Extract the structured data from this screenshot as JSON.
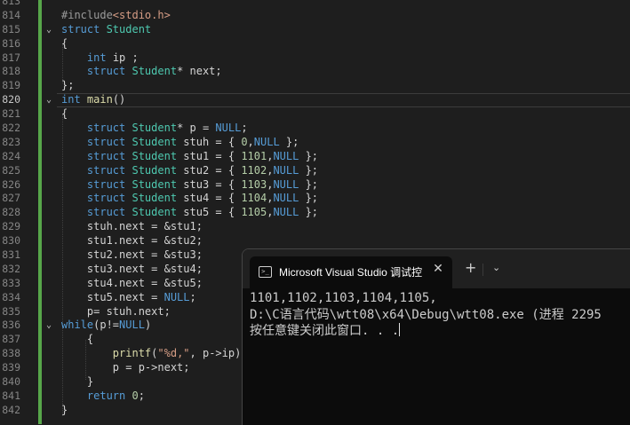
{
  "editor": {
    "lines": [
      {
        "num": "813",
        "code": []
      },
      {
        "num": "814",
        "code": [
          [
            "pre",
            "#include"
          ],
          [
            "str",
            "<stdio.h>"
          ]
        ]
      },
      {
        "num": "815",
        "fold": "⌄",
        "code": [
          [
            "kw",
            "struct "
          ],
          [
            "ty",
            "Student"
          ]
        ]
      },
      {
        "num": "816",
        "code": [
          [
            "",
            "{"
          ]
        ]
      },
      {
        "num": "817",
        "code": [
          [
            "",
            "    "
          ],
          [
            "kw",
            "int"
          ],
          [
            "",
            " ip ;"
          ]
        ]
      },
      {
        "num": "818",
        "code": [
          [
            "",
            "    "
          ],
          [
            "kw",
            "struct "
          ],
          [
            "ty",
            "Student"
          ],
          [
            "",
            "* next;"
          ]
        ]
      },
      {
        "num": "819",
        "code": [
          [
            "",
            "};"
          ]
        ]
      },
      {
        "num": "820",
        "fold": "⌄",
        "active": true,
        "code": [
          [
            "kw",
            "int "
          ],
          [
            "fn",
            "main"
          ],
          [
            "",
            "()"
          ]
        ]
      },
      {
        "num": "821",
        "code": [
          [
            "",
            "{"
          ]
        ]
      },
      {
        "num": "822",
        "code": [
          [
            "",
            "    "
          ],
          [
            "kw",
            "struct "
          ],
          [
            "ty",
            "Student"
          ],
          [
            "",
            "* p = "
          ],
          [
            "kw",
            "NULL"
          ],
          [
            "",
            ";"
          ]
        ]
      },
      {
        "num": "823",
        "code": [
          [
            "",
            "    "
          ],
          [
            "kw",
            "struct "
          ],
          [
            "ty",
            "Student"
          ],
          [
            "",
            " stuh = { "
          ],
          [
            "num",
            "0"
          ],
          [
            "",
            ","
          ],
          [
            "kw",
            "NULL"
          ],
          [
            "",
            " };"
          ]
        ]
      },
      {
        "num": "824",
        "code": [
          [
            "",
            "    "
          ],
          [
            "kw",
            "struct "
          ],
          [
            "ty",
            "Student"
          ],
          [
            "",
            " stu1 = { "
          ],
          [
            "num",
            "1101"
          ],
          [
            "",
            ","
          ],
          [
            "kw",
            "NULL"
          ],
          [
            "",
            " };"
          ]
        ]
      },
      {
        "num": "825",
        "code": [
          [
            "",
            "    "
          ],
          [
            "kw",
            "struct "
          ],
          [
            "ty",
            "Student"
          ],
          [
            "",
            " stu2 = { "
          ],
          [
            "num",
            "1102"
          ],
          [
            "",
            ","
          ],
          [
            "kw",
            "NULL"
          ],
          [
            "",
            " };"
          ]
        ]
      },
      {
        "num": "826",
        "code": [
          [
            "",
            "    "
          ],
          [
            "kw",
            "struct "
          ],
          [
            "ty",
            "Student"
          ],
          [
            "",
            " stu3 = { "
          ],
          [
            "num",
            "1103"
          ],
          [
            "",
            ","
          ],
          [
            "kw",
            "NULL"
          ],
          [
            "",
            " };"
          ]
        ]
      },
      {
        "num": "827",
        "code": [
          [
            "",
            "    "
          ],
          [
            "kw",
            "struct "
          ],
          [
            "ty",
            "Student"
          ],
          [
            "",
            " stu4 = { "
          ],
          [
            "num",
            "1104"
          ],
          [
            "",
            ","
          ],
          [
            "kw",
            "NULL"
          ],
          [
            "",
            " };"
          ]
        ]
      },
      {
        "num": "828",
        "code": [
          [
            "",
            "    "
          ],
          [
            "kw",
            "struct "
          ],
          [
            "ty",
            "Student"
          ],
          [
            "",
            " stu5 = { "
          ],
          [
            "num",
            "1105"
          ],
          [
            "",
            ","
          ],
          [
            "kw",
            "NULL"
          ],
          [
            "",
            " };"
          ]
        ]
      },
      {
        "num": "829",
        "code": [
          [
            "",
            "    stuh.next = &stu1;"
          ]
        ]
      },
      {
        "num": "830",
        "code": [
          [
            "",
            "    stu1.next = &stu2;"
          ]
        ]
      },
      {
        "num": "831",
        "code": [
          [
            "",
            "    stu2.next = &stu3;"
          ]
        ]
      },
      {
        "num": "832",
        "code": [
          [
            "",
            "    stu3.next = &stu4;"
          ]
        ]
      },
      {
        "num": "833",
        "code": [
          [
            "",
            "    stu4.next = &stu5;"
          ]
        ]
      },
      {
        "num": "834",
        "code": [
          [
            "",
            "    stu5.next = "
          ],
          [
            "kw",
            "NULL"
          ],
          [
            "",
            ";"
          ]
        ]
      },
      {
        "num": "835",
        "code": [
          [
            "",
            "    p= stuh.next;"
          ]
        ]
      },
      {
        "num": "836",
        "fold": "⌄",
        "code": [
          [
            "kw",
            "while"
          ],
          [
            "",
            "(p!="
          ],
          [
            "kw",
            "NULL"
          ],
          [
            "",
            ")"
          ]
        ]
      },
      {
        "num": "837",
        "code": [
          [
            "",
            "    {"
          ]
        ]
      },
      {
        "num": "838",
        "code": [
          [
            "",
            "        "
          ],
          [
            "fn",
            "printf"
          ],
          [
            "",
            "("
          ],
          [
            "str",
            "\"%d,\""
          ],
          [
            "",
            ", p->ip);"
          ]
        ]
      },
      {
        "num": "839",
        "code": [
          [
            "",
            "        p = p->next;"
          ]
        ]
      },
      {
        "num": "840",
        "code": [
          [
            "",
            "    }"
          ]
        ]
      },
      {
        "num": "841",
        "code": [
          [
            "",
            "    "
          ],
          [
            "kw",
            "return "
          ],
          [
            "num",
            "0"
          ],
          [
            "",
            ";"
          ]
        ]
      },
      {
        "num": "842",
        "code": [
          [
            "",
            "}"
          ]
        ]
      }
    ]
  },
  "terminal": {
    "tab_title": "Microsoft Visual Studio 调试控",
    "tab_icon": "terminal-icon",
    "close_glyph": "✕",
    "plus_glyph": "+",
    "dropdown_glyph": "⌄",
    "output": [
      "1101,1102,1103,1104,1105,",
      "D:\\C语言代码\\wtt08\\x64\\Debug\\wtt08.exe (进程 2295",
      "按任意键关闭此窗口. . ."
    ]
  },
  "colors": {
    "background": "#1e1e1e",
    "terminal_bg": "#0c0c0c",
    "keyword": "#569cd6",
    "type": "#4ec9b0",
    "function": "#dcdcaa",
    "string": "#d69d85",
    "number": "#b5cea8",
    "change_bar": "#57a64a"
  }
}
